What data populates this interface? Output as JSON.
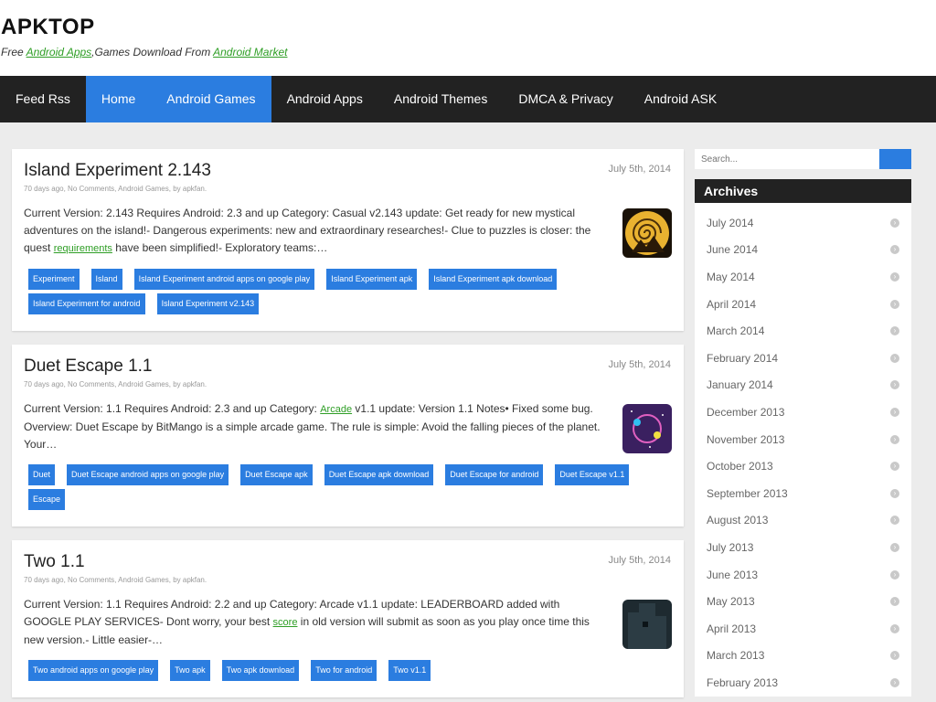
{
  "site": {
    "title": "APKTOP",
    "desc_prefix": "Free ",
    "desc_link1": "Android Apps",
    "desc_middle": ",Games Download From ",
    "desc_link2": "Android Market"
  },
  "nav": [
    {
      "label": "Feed Rss"
    },
    {
      "label": "Home"
    },
    {
      "label": "Android Games"
    },
    {
      "label": "Android Apps"
    },
    {
      "label": "Android Themes"
    },
    {
      "label": "DMCA & Privacy"
    },
    {
      "label": "Android ASK"
    }
  ],
  "posts": [
    {
      "title": "Island Experiment 2.143",
      "date": "July 5th, 2014",
      "meta": "70 days ago, No Comments, Android Games, by apkfan.",
      "excerpt_before": "Current Version: 2.143 Requires Android: 2.3 and up Category: Casual v2.143 update: Get ready for new mystical adventures on the island!- Dangerous experiments: new and extraordinary researches!- Clue to puzzles is closer: the quest ",
      "excerpt_link": "requirements",
      "excerpt_after": " have been simplified!- Exploratory teams:…",
      "tags": [
        "Experiment",
        "Island",
        "Island Experiment android apps on google play",
        "Island Experiment apk",
        "Island Experiment apk download",
        "Island Experiment for android",
        "Island Experiment v2.143"
      ]
    },
    {
      "title": "Duet Escape 1.1",
      "date": "July 5th, 2014",
      "meta": "70 days ago, No Comments, Android Games, by apkfan.",
      "excerpt_before": "Current Version: 1.1 Requires Android: 2.3 and up Category: ",
      "excerpt_link": "Arcade",
      "excerpt_after": " v1.1 update: Version 1.1 Notes• Fixed some bug. Overview: Duet Escape by BitMango is a simple arcade game. The rule is simple: Avoid the falling pieces of the planet. Your…",
      "tags": [
        "Duet",
        "Duet Escape android apps on google play",
        "Duet Escape apk",
        "Duet Escape apk download",
        "Duet Escape for android",
        "Duet Escape v1.1",
        "Escape"
      ]
    },
    {
      "title": "Two 1.1",
      "date": "July 5th, 2014",
      "meta": "70 days ago, No Comments, Android Games, by apkfan.",
      "excerpt_before": "Current Version: 1.1 Requires Android: 2.2 and up Category: Arcade v1.1 update: LEADERBOARD added with GOOGLE PLAY SERVICES- Dont worry, your best ",
      "excerpt_link": "score",
      "excerpt_after": " in old version will submit as soon as you play once time this new version.- Little easier-…",
      "tags": [
        "Two android apps on google play",
        "Two apk",
        "Two apk download",
        "Two for android",
        "Two v1.1"
      ]
    }
  ],
  "sidebar": {
    "search_placeholder": "Search...",
    "archives_title": "Archives",
    "archives": [
      "July 2014",
      "June 2014",
      "May 2014",
      "April 2014",
      "March 2014",
      "February 2014",
      "January 2014",
      "December 2013",
      "November 2013",
      "October 2013",
      "September 2013",
      "August 2013",
      "July 2013",
      "June 2013",
      "May 2013",
      "April 2013",
      "March 2013",
      "February 2013"
    ]
  },
  "colors": {
    "accent": "#2b7de0",
    "nav_bg": "#222222",
    "link_green": "#2e9e25"
  }
}
